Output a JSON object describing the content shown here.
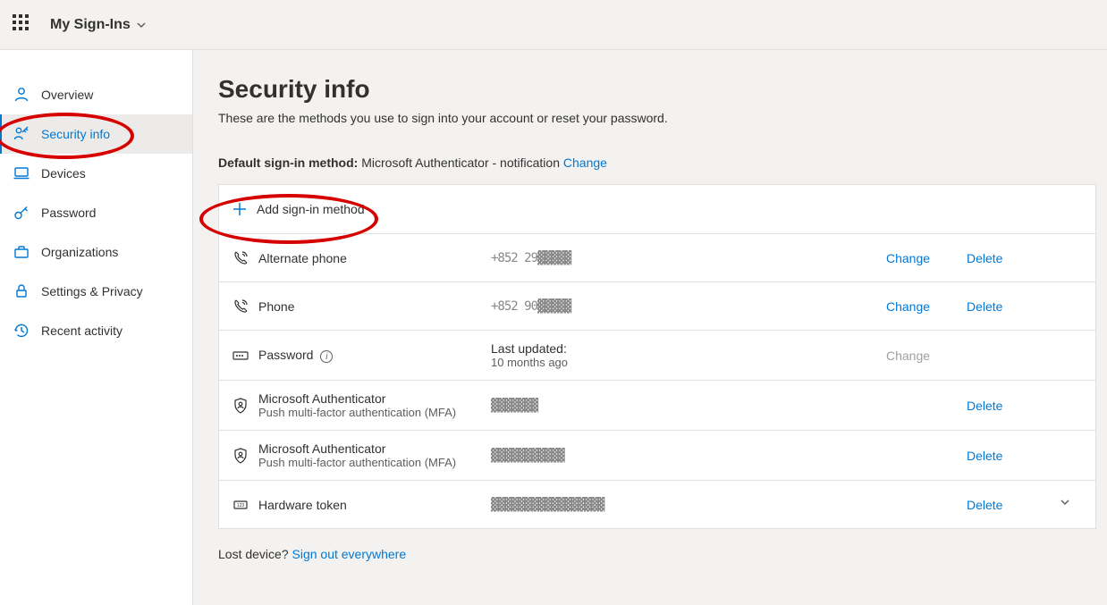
{
  "header": {
    "app_title": "My Sign-Ins"
  },
  "sidebar": {
    "items": [
      {
        "label": "Overview"
      },
      {
        "label": "Security info"
      },
      {
        "label": "Devices"
      },
      {
        "label": "Password"
      },
      {
        "label": "Organizations"
      },
      {
        "label": "Settings & Privacy"
      },
      {
        "label": "Recent activity"
      }
    ]
  },
  "page": {
    "title": "Security info",
    "subtitle": "These are the methods you use to sign into your account or reset your password."
  },
  "default_method": {
    "label": "Default sign-in method:",
    "value": "Microsoft Authenticator - notification",
    "change": "Change"
  },
  "add": {
    "label": "Add sign-in method"
  },
  "methods": [
    {
      "icon": "phone",
      "name": "Alternate phone",
      "sub": "",
      "value": "+852 29▓▓▓▓▓",
      "value_sub": "",
      "change": "Change",
      "delete": "Delete",
      "expand": false
    },
    {
      "icon": "phone",
      "name": "Phone",
      "sub": "",
      "value": "+852 90▓▓▓▓▓",
      "value_sub": "",
      "change": "Change",
      "delete": "Delete",
      "expand": false
    },
    {
      "icon": "password",
      "name": "Password",
      "sub": "",
      "value": "Last updated:",
      "value_sub": "10 months ago",
      "change": "Change",
      "change_disabled": true,
      "delete": "",
      "expand": false,
      "info": true
    },
    {
      "icon": "authenticator",
      "name": "Microsoft Authenticator",
      "sub": "Push multi-factor authentication (MFA)",
      "value": "▓▓▓▓▓▓▓",
      "value_sub": "",
      "change": "",
      "delete": "Delete",
      "expand": false
    },
    {
      "icon": "authenticator",
      "name": "Microsoft Authenticator",
      "sub": "Push multi-factor authentication (MFA)",
      "value": "▓▓▓▓▓▓▓▓▓▓▓",
      "value_sub": "",
      "change": "",
      "delete": "Delete",
      "expand": false
    },
    {
      "icon": "token",
      "name": "Hardware token",
      "sub": "",
      "value": "▓▓▓▓▓▓▓▓▓▓▓▓▓▓▓▓▓",
      "value_sub": "",
      "change": "",
      "delete": "Delete",
      "expand": true
    }
  ],
  "lost": {
    "prefix": "Lost device? ",
    "link": "Sign out everywhere"
  }
}
